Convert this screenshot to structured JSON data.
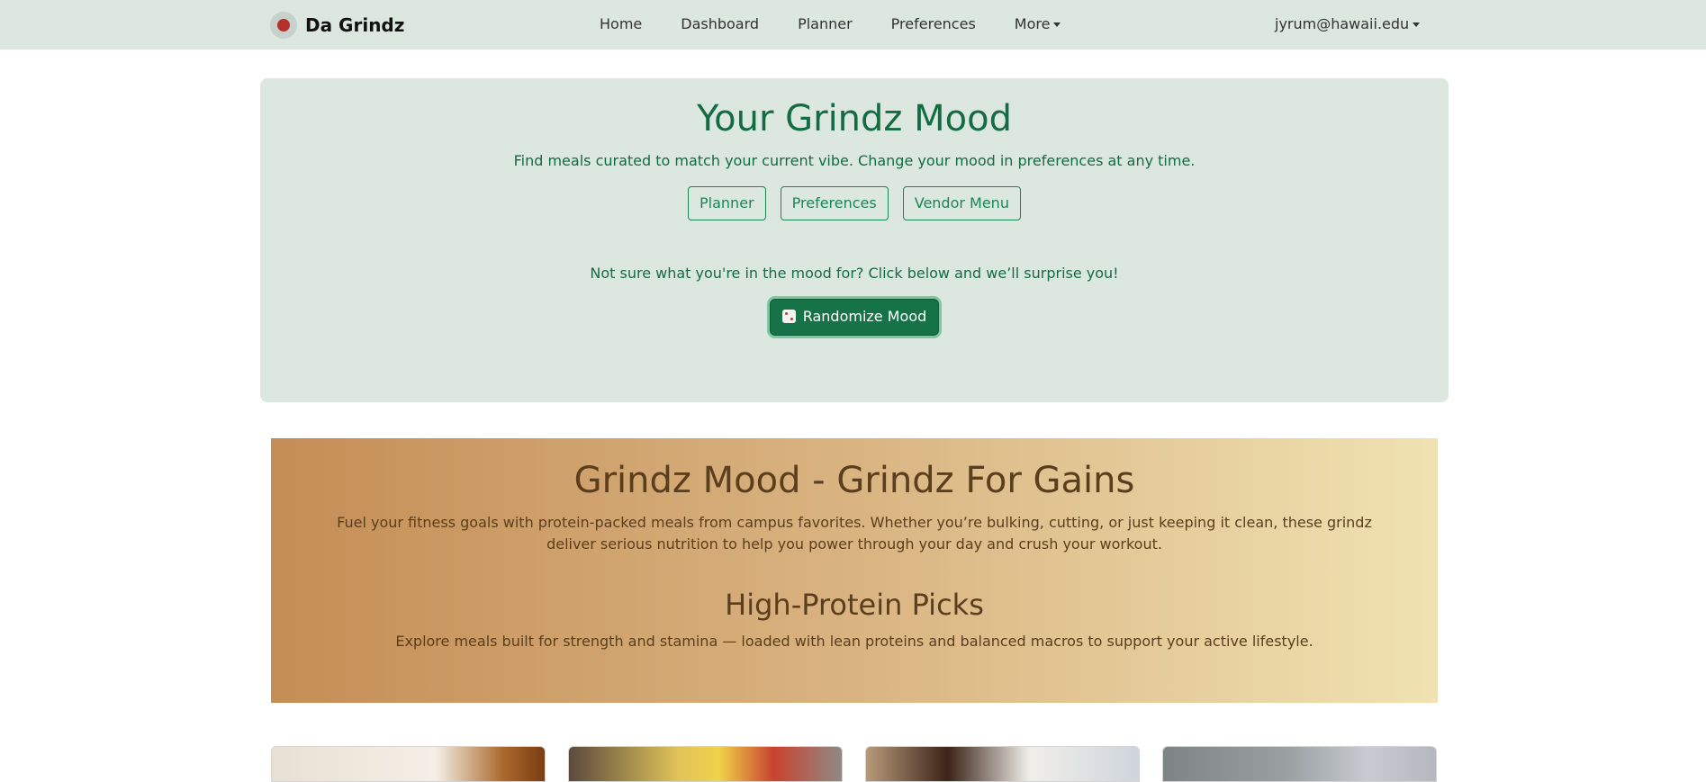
{
  "navbar": {
    "brand": "Da Grindz",
    "links": [
      "Home",
      "Dashboard",
      "Planner",
      "Preferences",
      "More"
    ],
    "user": "jyrum@hawaii.edu"
  },
  "mood": {
    "title": "Your Grindz Mood",
    "subtitle": "Find meals curated to match your current vibe. Change your mood in preferences at any time.",
    "buttons": [
      "Planner",
      "Preferences",
      "Vendor Menu"
    ],
    "surprise_text": "Not sure what you're in the mood for? Click below and we’ll surprise you!",
    "randomize_label": "Randomize Mood"
  },
  "gains": {
    "title": "Grindz Mood - Grindz For Gains",
    "description": "Fuel your fitness goals with protein-packed meals from campus favorites. Whether you’re bulking, cutting, or just keeping it clean, these grindz deliver serious nutrition to help you power through your day and crush your workout.",
    "section_title": "High-Protein Picks",
    "section_description": "Explore meals built for strength and stamina — loaded with lean proteins and balanced macros to support your active lifestyle."
  },
  "colors": {
    "accent_green": "#198754",
    "panel_bg": "#dce7e0",
    "gradient_start": "#c48d55",
    "gradient_end": "#f0e2b2"
  }
}
